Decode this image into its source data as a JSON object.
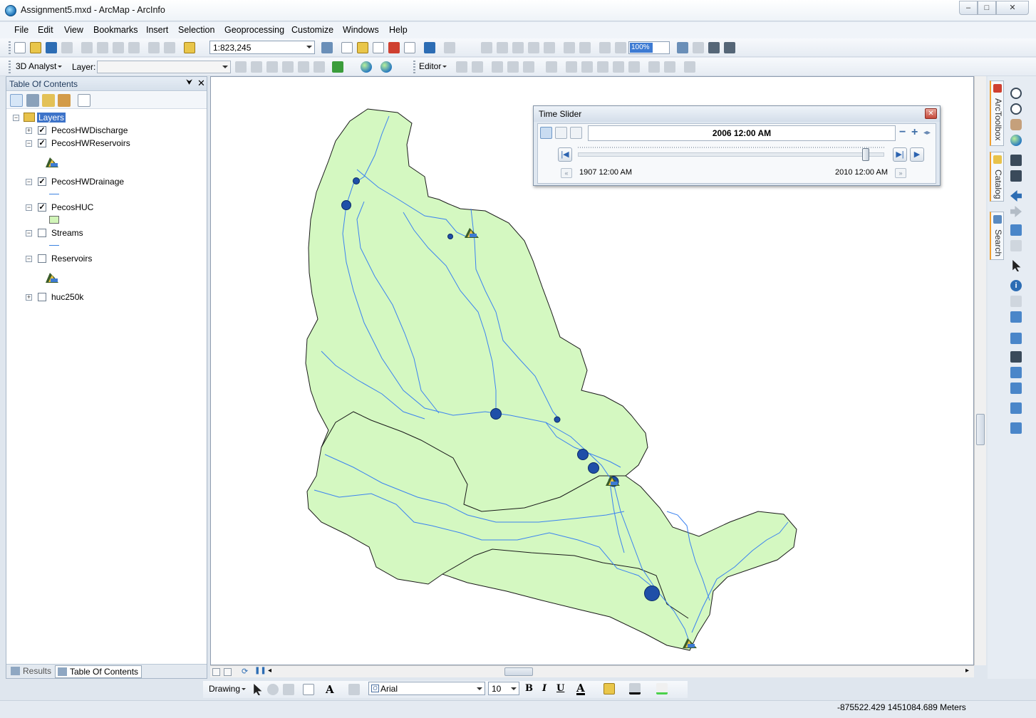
{
  "window": {
    "title": "Assignment5.mxd - ArcMap - ArcInfo",
    "minimize": "–",
    "maximize": "□",
    "close": "✕"
  },
  "menu": [
    "File",
    "Edit",
    "View",
    "Bookmarks",
    "Insert",
    "Selection",
    "Geoprocessing",
    "Customize",
    "Windows",
    "Help"
  ],
  "standard_toolbar": {
    "scale": "1:823,245",
    "zoom_percent": "100%"
  },
  "analyst_toolbar": {
    "analyst_label": "3D Analyst",
    "layer_label": "Layer:",
    "layer_value": "",
    "editor_label": "Editor"
  },
  "toc": {
    "title": "Table Of Contents",
    "pin": "⮟",
    "close": "✕",
    "layers_root": "Layers",
    "layers": [
      {
        "name": "PecosHWDischarge",
        "checked": true,
        "expanded": false,
        "symbol": "none"
      },
      {
        "name": "PecosHWReservoirs",
        "checked": true,
        "expanded": true,
        "symbol": "reservoir-icon"
      },
      {
        "name": "PecosHWDrainage",
        "checked": true,
        "expanded": true,
        "symbol": "line"
      },
      {
        "name": "PecosHUC",
        "checked": true,
        "expanded": true,
        "symbol": "polygon"
      },
      {
        "name": "Streams",
        "checked": false,
        "expanded": true,
        "symbol": "line"
      },
      {
        "name": "Reservoirs",
        "checked": false,
        "expanded": true,
        "symbol": "reservoir-icon"
      },
      {
        "name": "huc250k",
        "checked": false,
        "expanded": false,
        "symbol": "none"
      }
    ],
    "tabs": [
      {
        "label": "Results",
        "active": false
      },
      {
        "label": "Table Of Contents",
        "active": true
      }
    ]
  },
  "time_slider": {
    "title": "Time Slider",
    "current_time": "2006 12:00 AM",
    "start_time": "1907 12:00 AM",
    "end_time": "2010 12:00 AM",
    "minus": "−",
    "plus": "+",
    "slider_position": 0.95
  },
  "right_tabs": [
    "ArcToolbox",
    "Catalog",
    "Search"
  ],
  "drawing_toolbar": {
    "drawing_label": "Drawing",
    "font": "Arial",
    "size": "10",
    "bold": "B",
    "italic": "I",
    "underline": "U",
    "font_color_label": "A"
  },
  "status": {
    "coordinates": "-875522.429  1451084.689 Meters"
  },
  "map": {
    "fill_color": "#d4f8c1",
    "stream_color": "#3b82f0",
    "gauge_color": "#1f4fa8"
  }
}
